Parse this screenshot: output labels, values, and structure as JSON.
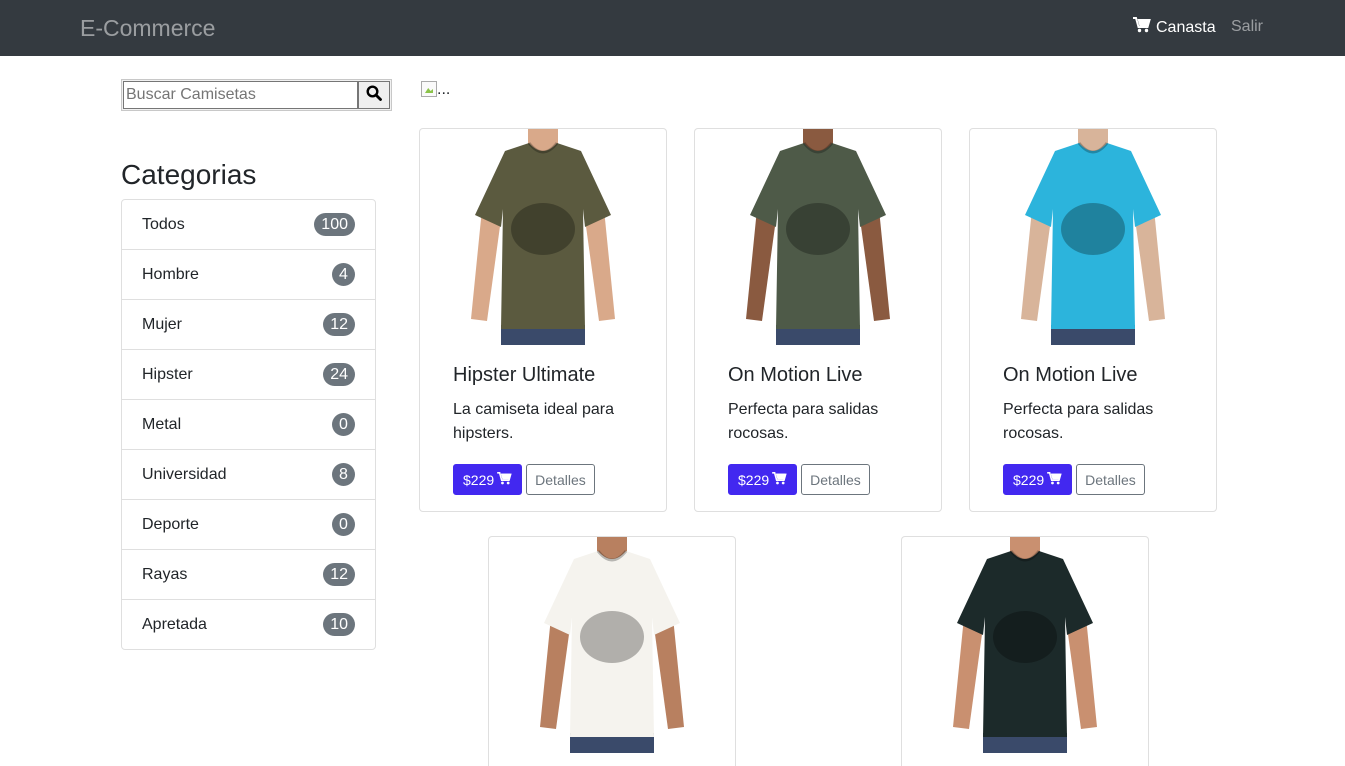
{
  "navbar": {
    "brand": "E-Commerce",
    "cart_label": "Canasta",
    "logout_label": "Salir"
  },
  "search": {
    "placeholder": "Buscar Camisetas"
  },
  "categories": {
    "title": "Categorias",
    "items": [
      {
        "label": "Todos",
        "count": "100"
      },
      {
        "label": "Hombre",
        "count": "4"
      },
      {
        "label": "Mujer",
        "count": "12"
      },
      {
        "label": "Hipster",
        "count": "24"
      },
      {
        "label": "Metal",
        "count": "0"
      },
      {
        "label": "Universidad",
        "count": "8"
      },
      {
        "label": "Deporte",
        "count": "0"
      },
      {
        "label": "Rayas",
        "count": "12"
      },
      {
        "label": "Apretada",
        "count": "10"
      }
    ]
  },
  "banner": {
    "alt": "..."
  },
  "products": [
    {
      "title": "Hipster Ultimate",
      "description": "La camiseta ideal para hipsters.",
      "price": "$229",
      "details_label": "Detalles",
      "shirt_color": "#5b5a3f",
      "skin": "#d9a98a",
      "bg": "#ffffff"
    },
    {
      "title": "On Motion Live",
      "description": "Perfecta para salidas rocosas.",
      "price": "$229",
      "details_label": "Detalles",
      "shirt_color": "#4e5a48",
      "skin": "#8a5a40",
      "bg": "#ffffff"
    },
    {
      "title": "On Motion Live",
      "description": "Perfecta para salidas rocosas.",
      "price": "$229",
      "details_label": "Detalles",
      "shirt_color": "#2cb4dc",
      "skin": "#d8b49a",
      "bg": "#ffffff"
    },
    {
      "shirt_color": "#f5f3ee",
      "skin": "#b88060",
      "bg": "#ffffff"
    },
    {
      "shirt_color": "#1c2a2a",
      "skin": "#c99070",
      "bg": "#ffffff"
    }
  ],
  "colors": {
    "navbar_bg": "#343a40",
    "primary": "#4228f0",
    "badge": "#6c757d"
  }
}
